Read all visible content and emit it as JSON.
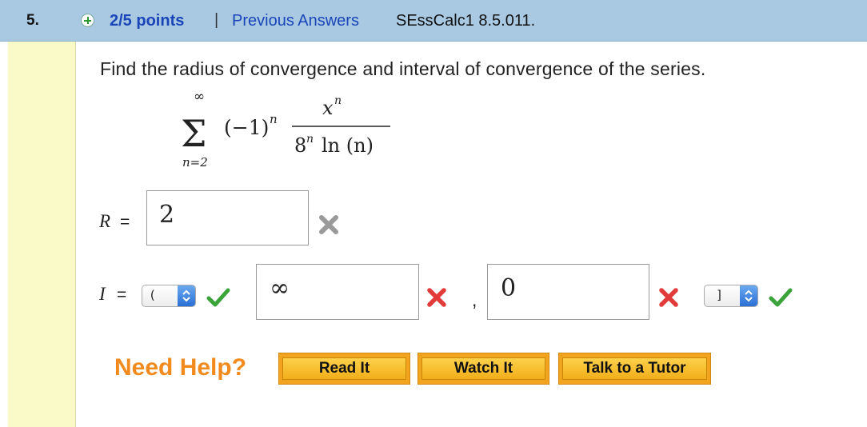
{
  "question": {
    "number": "5.",
    "points": "2/5 points",
    "separator": "|",
    "previous_answers": "Previous Answers",
    "source": "SEssCalc1 8.5.011."
  },
  "prompt": "Find the radius of convergence and interval of convergence of the series.",
  "series": {
    "upper": "∞",
    "lower": "n=2",
    "sign_term": "(−1)",
    "sign_exp": "n",
    "numerator_base": "x",
    "numerator_exp": "n",
    "denominator_base": "8",
    "denominator_exp": "n",
    "denominator_tail": "ln (n)"
  },
  "radius": {
    "label": "R",
    "equals": "=",
    "value": "2",
    "status": "incorrect"
  },
  "interval": {
    "label": "I",
    "equals": "=",
    "left_bracket": "(",
    "left_bracket_status": "correct",
    "left_value": "∞",
    "left_status": "incorrect",
    "comma": ",",
    "right_value": "0",
    "right_status": "incorrect",
    "right_bracket": "]",
    "right_bracket_status": "correct"
  },
  "help": {
    "label": "Need Help?",
    "buttons": [
      "Read It",
      "Watch It",
      "Talk to a Tutor"
    ]
  },
  "colors": {
    "header_bg": "#a9c9e3",
    "link": "#1a45b8",
    "help_orange": "#f28a1e",
    "correct": "#3aa33a",
    "incorrect": "#e23b3b",
    "grey_x": "#9a9a9a"
  }
}
